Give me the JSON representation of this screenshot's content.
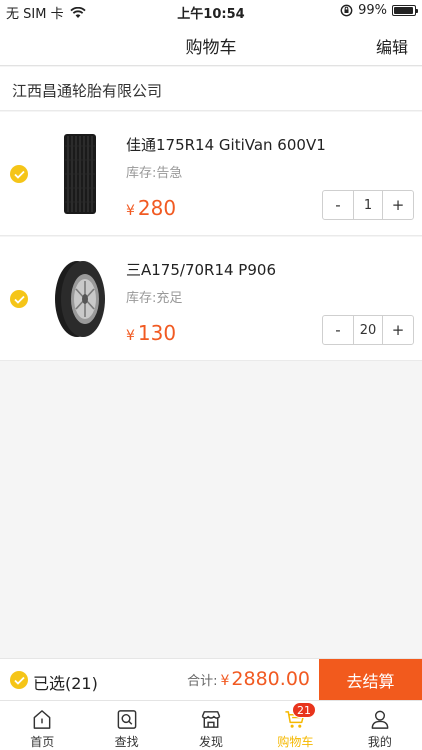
{
  "status_bar": {
    "carrier": "无 SIM 卡",
    "time": "上午10:54",
    "battery": "99%"
  },
  "nav": {
    "title": "购物车",
    "edit_label": "编辑"
  },
  "shop": {
    "name": "江西昌通轮胎有限公司"
  },
  "items": [
    {
      "name": "佳通175R14 GitiVan 600V1",
      "stock": "库存:告急",
      "currency": "¥",
      "price": "280",
      "qty": "1",
      "minus": "-",
      "plus": "+"
    },
    {
      "name": "三A175/70R14 P906",
      "stock": "库存:充足",
      "currency": "¥",
      "price": "130",
      "qty": "20",
      "minus": "-",
      "plus": "+"
    }
  ],
  "checkout": {
    "selected_label": "已选(21)",
    "total_label": "合计:",
    "currency": "¥",
    "total": "2880.00",
    "button_label": "去结算"
  },
  "tabs": [
    {
      "label": "首页",
      "icon": "home-icon"
    },
    {
      "label": "查找",
      "icon": "search-icon"
    },
    {
      "label": "发现",
      "icon": "shop-icon"
    },
    {
      "label": "购物车",
      "icon": "cart-icon",
      "badge": "21",
      "active": true
    },
    {
      "label": "我的",
      "icon": "user-icon"
    }
  ],
  "colors": {
    "accent": "#f15a22",
    "checkbox": "#f5c518",
    "active_tab": "#f5b800",
    "badge": "#e8341c"
  }
}
